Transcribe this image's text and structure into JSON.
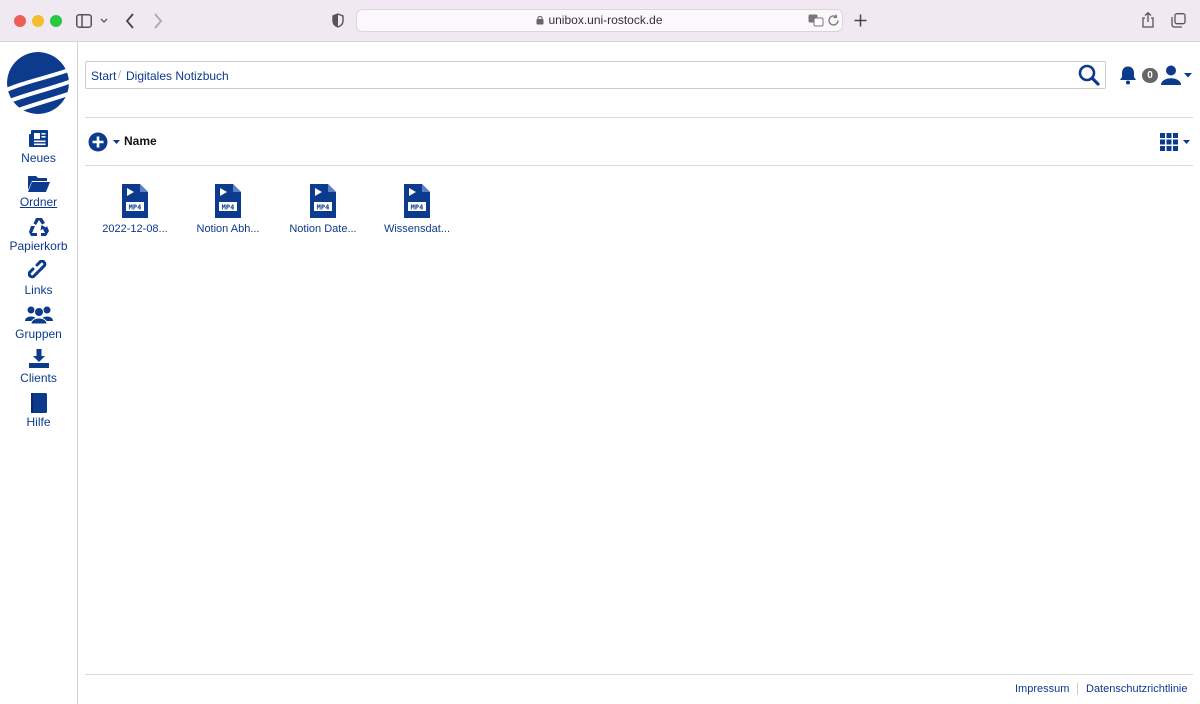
{
  "browser": {
    "url": "unibox.uni-rostock.de"
  },
  "sidebar": {
    "items": [
      {
        "label": "Neues",
        "icon": "newspaper-icon"
      },
      {
        "label": "Ordner",
        "icon": "folder-open-icon",
        "active": true
      },
      {
        "label": "Papierkorb",
        "icon": "recycle-icon"
      },
      {
        "label": "Links",
        "icon": "link-icon"
      },
      {
        "label": "Gruppen",
        "icon": "users-icon"
      },
      {
        "label": "Clients",
        "icon": "download-icon"
      },
      {
        "label": "Hilfe",
        "icon": "book-icon"
      }
    ]
  },
  "breadcrumb": {
    "items": [
      "Start",
      "Digitales Notizbuch"
    ],
    "separator": "/"
  },
  "header": {
    "notification_count": "0"
  },
  "toolbar": {
    "sort_label": "Name"
  },
  "files": [
    {
      "name": "2022-12-08...",
      "type": "MP4"
    },
    {
      "name": "Notion Abh...",
      "type": "MP4"
    },
    {
      "name": "Notion Date...",
      "type": "MP4"
    },
    {
      "name": "Wissensdat...",
      "type": "MP4"
    }
  ],
  "footer": {
    "impressum": "Impressum",
    "privacy": "Datenschutzrichtlinie"
  },
  "colors": {
    "brand": "#0c3a8c",
    "browser_bar": "#f1e9f2"
  }
}
